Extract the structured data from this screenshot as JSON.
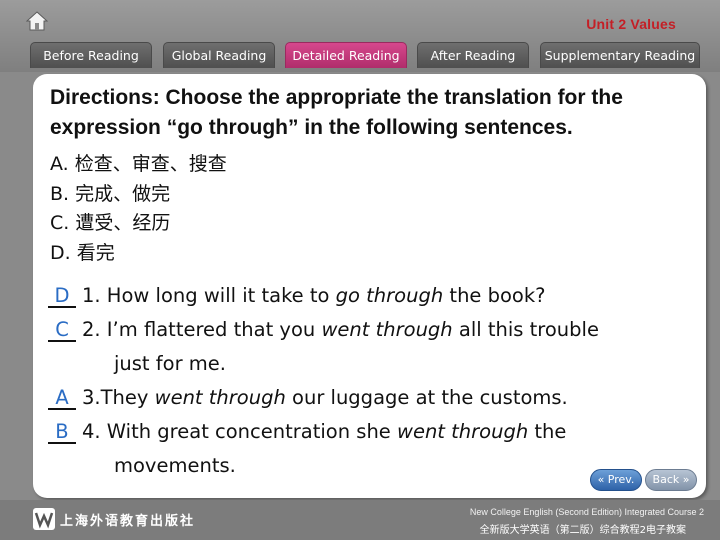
{
  "header": {
    "unit_title": "Unit 2  Values"
  },
  "tabs": [
    {
      "label": "Before Reading",
      "active": false
    },
    {
      "label": "Global Reading",
      "active": false
    },
    {
      "label": "Detailed Reading",
      "active": true
    },
    {
      "label": "After Reading",
      "active": false
    },
    {
      "label": "Supplementary Reading",
      "active": false
    }
  ],
  "directions": "Directions: Choose the appropriate the translation for the expression “go through” in the following sentences.",
  "options": [
    "A. 检查、审查、搜查",
    "B. 完成、做完",
    "C. 遭受、经历",
    "D. 看完"
  ],
  "sentences": [
    {
      "answer": "D",
      "pre": "1. How long will it take to ",
      "phrase": "go through",
      "post": " the book?",
      "cont": ""
    },
    {
      "answer": "C",
      "pre": "2. I’m flattered that you ",
      "phrase": "went through",
      "post": " all this trouble",
      "cont": "just for me."
    },
    {
      "answer": "A",
      "pre": "3.They ",
      "phrase": "went through",
      "post": " our luggage at the customs.",
      "cont": ""
    },
    {
      "answer": "B",
      "pre": "4. With great concentration she ",
      "phrase": "went through",
      "post": " the",
      "cont": "movements."
    }
  ],
  "nav": {
    "prev_label": "« Prev.",
    "back_label": "Back »"
  },
  "footer": {
    "publisher": "上海外语教育出版社",
    "course_en": "New College English (Second Edition) Integrated Course 2",
    "course_cn": "全新版大学英语（第二版）综合教程2电子教案"
  },
  "colors": {
    "unit_title": "#c41f26",
    "active_tab": "#c23a7c",
    "answer": "#2a6cc4"
  }
}
